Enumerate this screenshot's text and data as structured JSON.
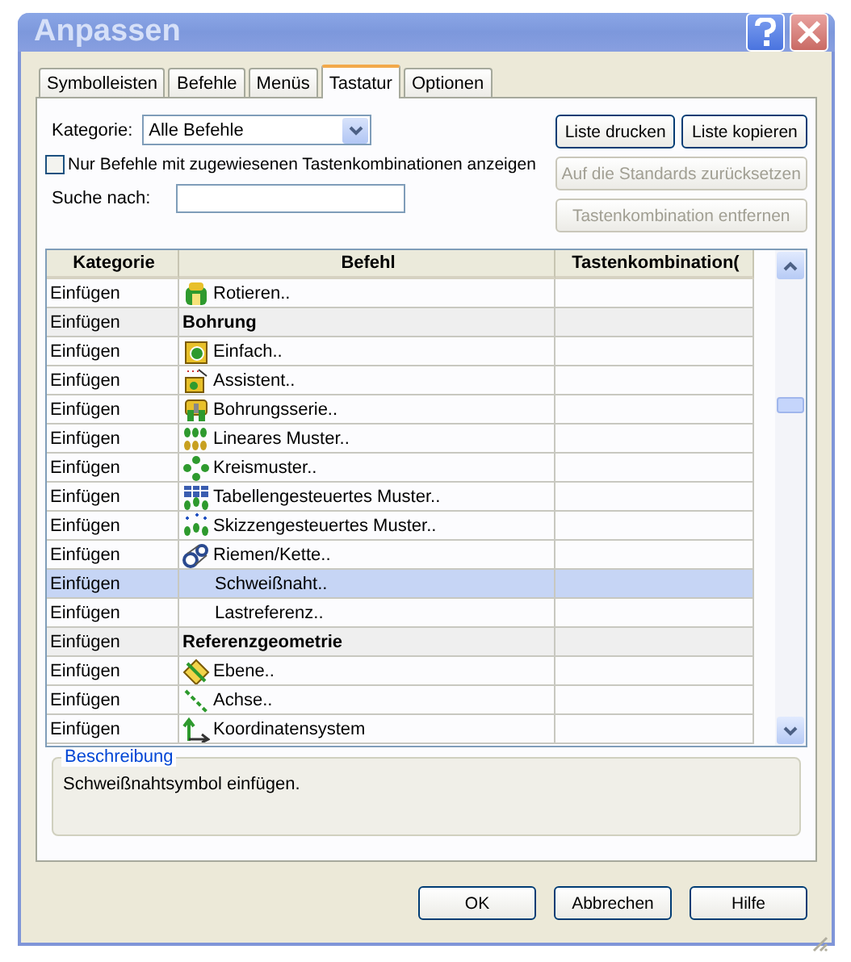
{
  "window": {
    "title": "Anpassen"
  },
  "tabs": [
    {
      "label": "Symbolleisten",
      "selected": false
    },
    {
      "label": "Befehle",
      "selected": false
    },
    {
      "label": "Menüs",
      "selected": false
    },
    {
      "label": "Tastatur",
      "selected": true
    },
    {
      "label": "Optionen",
      "selected": false
    }
  ],
  "category": {
    "label": "Kategorie:",
    "value": "Alle Befehle"
  },
  "only_assigned": {
    "label": "Nur Befehle mit zugewiesenen Tastenkombinationen anzeigen",
    "checked": false
  },
  "search": {
    "label": "Suche nach:"
  },
  "side_buttons": [
    {
      "label": "Liste drucken",
      "disabled": false
    },
    {
      "label": "Liste kopieren",
      "disabled": false
    },
    {
      "label": "Auf die Standards zurücksetzen",
      "disabled": true
    },
    {
      "label": "Tastenkombination entfernen",
      "disabled": true
    }
  ],
  "table": {
    "columns": [
      "Kategorie",
      "Befehl",
      "Tastenkombination("
    ],
    "rows": [
      {
        "kind": "command",
        "category": "Einfügen",
        "command": "Rotieren..",
        "icon": true,
        "selected": false
      },
      {
        "kind": "group",
        "category": "Einfügen",
        "command": "Bohrung",
        "selected": false
      },
      {
        "kind": "command",
        "category": "Einfügen",
        "command": "Einfach..",
        "icon": true,
        "selected": false
      },
      {
        "kind": "command",
        "category": "Einfügen",
        "command": "Assistent..",
        "icon": true,
        "selected": false
      },
      {
        "kind": "command",
        "category": "Einfügen",
        "command": "Bohrungsserie..",
        "icon": true,
        "selected": false
      },
      {
        "kind": "command",
        "category": "Einfügen",
        "command": "Lineares Muster..",
        "icon": true,
        "selected": false
      },
      {
        "kind": "command",
        "category": "Einfügen",
        "command": "Kreismuster..",
        "icon": true,
        "selected": false
      },
      {
        "kind": "command",
        "category": "Einfügen",
        "command": "Tabellengesteuertes Muster..",
        "icon": true,
        "selected": false
      },
      {
        "kind": "command",
        "category": "Einfügen",
        "command": "Skizzengesteuertes Muster..",
        "icon": true,
        "selected": false
      },
      {
        "kind": "command",
        "category": "Einfügen",
        "command": "Riemen/Kette..",
        "icon": true,
        "selected": false
      },
      {
        "kind": "command",
        "category": "Einfügen",
        "command": "Schweißnaht..",
        "icon": false,
        "selected": true
      },
      {
        "kind": "command",
        "category": "Einfügen",
        "command": "Lastreferenz..",
        "icon": false,
        "selected": false
      },
      {
        "kind": "group",
        "category": "Einfügen",
        "command": "Referenzgeometrie",
        "selected": false
      },
      {
        "kind": "command",
        "category": "Einfügen",
        "command": "Ebene..",
        "icon": true,
        "selected": false
      },
      {
        "kind": "command",
        "category": "Einfügen",
        "command": "Achse..",
        "icon": true,
        "selected": false
      },
      {
        "kind": "command",
        "category": "Einfügen",
        "command": "Koordinatensystem",
        "icon": true,
        "selected": false
      }
    ]
  },
  "description": {
    "title": "Beschreibung",
    "text": "Schweißnahtsymbol einfügen."
  },
  "buttons": [
    "OK",
    "Abbrechen",
    "Hilfe"
  ]
}
